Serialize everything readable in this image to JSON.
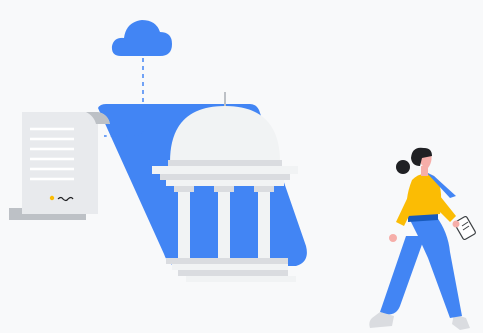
{
  "illustration": {
    "elements": [
      "cloud-icon",
      "document-scroll-icon",
      "government-building-icon",
      "walking-person"
    ]
  },
  "colors": {
    "background": "#f8f9fa",
    "accent_blue": "#4285f4",
    "dark_blue": "#185abc",
    "pale_blue": "#aecbfa",
    "paper": "#e8eaed",
    "paper_shadow": "#bdc1c6",
    "building_white": "#f1f3f4",
    "building_grey": "#dadce0",
    "shirt_yellow": "#fbbc04",
    "hair": "#202124",
    "skin": "#f6aea9",
    "shoes": "#dadce0"
  }
}
